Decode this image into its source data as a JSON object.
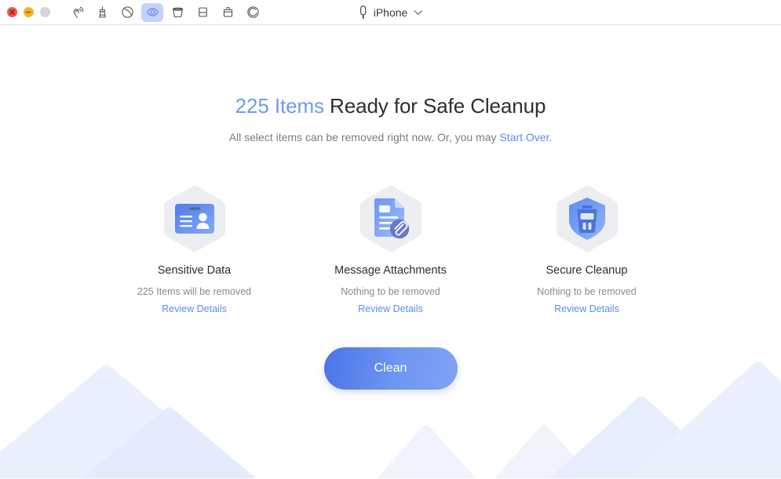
{
  "window": {
    "traffic_lights": [
      {
        "name": "close",
        "glyph": "×",
        "color": "#f1554c"
      },
      {
        "name": "minimize",
        "glyph": "−",
        "color": "#f2b52b"
      },
      {
        "name": "maximize",
        "glyph": "",
        "color": "#d4d4d6"
      }
    ],
    "toolbar": [
      {
        "id": "airdrop-icon",
        "label": "AirDrop",
        "active": false
      },
      {
        "id": "cleanup-icon",
        "label": "Cleanup",
        "active": false
      },
      {
        "id": "eraser-icon",
        "label": "Eraser",
        "active": false
      },
      {
        "id": "privacy-eye-icon",
        "label": "Privacy",
        "active": true
      },
      {
        "id": "trash-icon",
        "label": "Trash",
        "active": false
      },
      {
        "id": "storage-icon",
        "label": "Storage",
        "active": false
      },
      {
        "id": "toolkit-icon",
        "label": "Toolkit",
        "active": false
      },
      {
        "id": "refresh-icon",
        "label": "Refresh",
        "active": false
      }
    ],
    "device": {
      "icon": "lightning-connector-icon",
      "name": "iPhone",
      "chevron": "chevron-down-icon"
    }
  },
  "main": {
    "headline": {
      "count": "225 Items",
      "rest": " Ready for Safe Cleanup"
    },
    "subtitle": {
      "before": "All select items can be removed right now. Or, you may ",
      "link": "Start Over",
      "after": "."
    },
    "categories": [
      {
        "icon": "id-card-icon",
        "title": "Sensitive Data",
        "status": "225 Items will be removed",
        "link": "Review Details"
      },
      {
        "icon": "document-attachment-icon",
        "title": "Message Attachments",
        "status": "Nothing to be removed",
        "link": "Review Details"
      },
      {
        "icon": "shield-trash-icon",
        "title": "Secure Cleanup",
        "status": "Nothing to be removed",
        "link": "Review Details"
      }
    ],
    "clean_button": "Clean"
  },
  "colors": {
    "accent_blue": "#5b8def",
    "headline_blue": "#6e9bf0",
    "text_dark": "#2e2e31",
    "text_muted": "#8b8b91",
    "hex_bg": "#eceef2",
    "mountain_light": "#eaf0fd",
    "mountain_mid": "#dce7fb"
  }
}
